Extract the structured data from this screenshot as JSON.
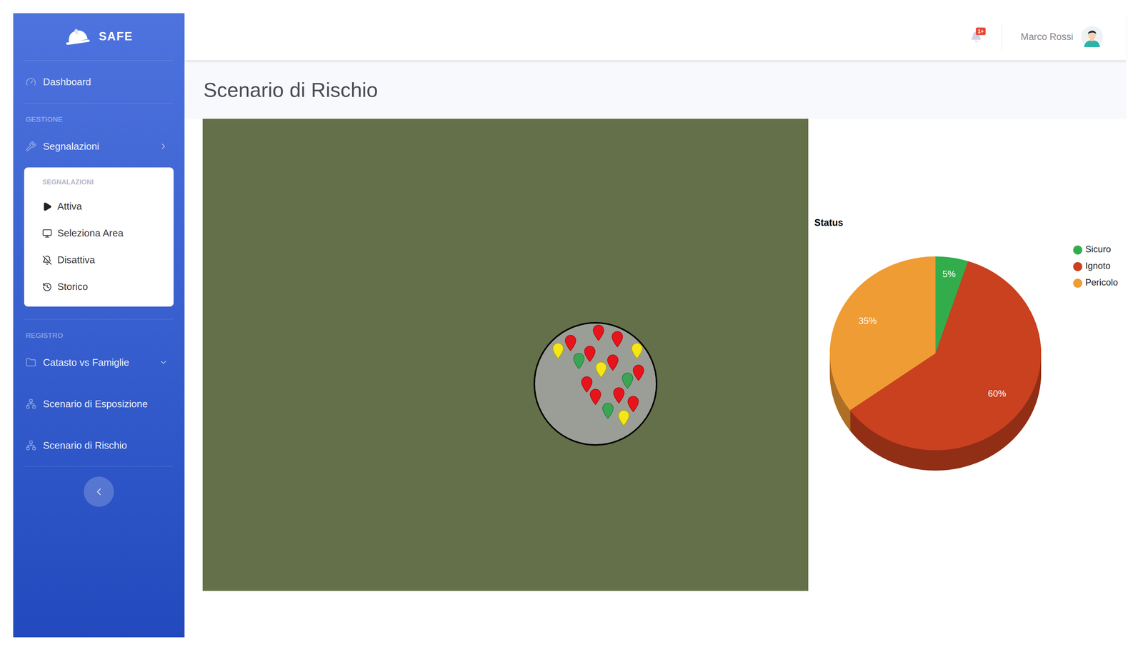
{
  "sidebar": {
    "brand": "SAFE",
    "top_items": [
      {
        "label": "Dashboard"
      }
    ],
    "sections": [
      {
        "heading": "GESTIONE",
        "items": [
          {
            "label": "Segnalazioni",
            "kind": "group",
            "expanded": true,
            "submenu": {
              "heading": "SEGNALAZIONI",
              "items": [
                {
                  "label": "Attiva"
                },
                {
                  "label": "Seleziona Area"
                },
                {
                  "label": "Disattiva"
                },
                {
                  "label": "Storico"
                }
              ]
            }
          }
        ]
      },
      {
        "heading": "REGISTRO",
        "items": [
          {
            "label": "Catasto vs Famiglie",
            "kind": "group",
            "expanded": false
          },
          {
            "label": "Scenario di Esposizione",
            "kind": "link"
          },
          {
            "label": "Scenario di Rischio",
            "kind": "link"
          }
        ]
      }
    ]
  },
  "topbar": {
    "notifications": {
      "badge": "1+"
    },
    "user": {
      "name": "Marco Rossi"
    }
  },
  "page": {
    "title": "Scenario di Rischio"
  },
  "map": {
    "pins": [
      {
        "color": "#e8141b"
      },
      {
        "color": "#e8141b"
      },
      {
        "color": "#e8141b"
      },
      {
        "color": "#f5e616"
      },
      {
        "color": "#f5e616"
      },
      {
        "color": "#e8141b"
      },
      {
        "color": "#3aa655"
      },
      {
        "color": "#e8141b"
      },
      {
        "color": "#f5e616"
      },
      {
        "color": "#e8141b"
      },
      {
        "color": "#3aa655"
      },
      {
        "color": "#e8141b"
      },
      {
        "color": "#e8141b"
      },
      {
        "color": "#e8141b"
      },
      {
        "color": "#e8141b"
      },
      {
        "color": "#3aa655"
      },
      {
        "color": "#f5e616"
      }
    ]
  },
  "chart": {
    "title": "Status",
    "values": [
      5,
      60,
      35
    ],
    "value_labels": [
      "5%",
      "60%",
      "35%"
    ],
    "legend": [
      {
        "label": "Sicuro",
        "color": "#33ad4c"
      },
      {
        "label": "Ignoto",
        "color": "#c9411f"
      },
      {
        "label": "Pericolo",
        "color": "#f09c35"
      }
    ]
  }
}
